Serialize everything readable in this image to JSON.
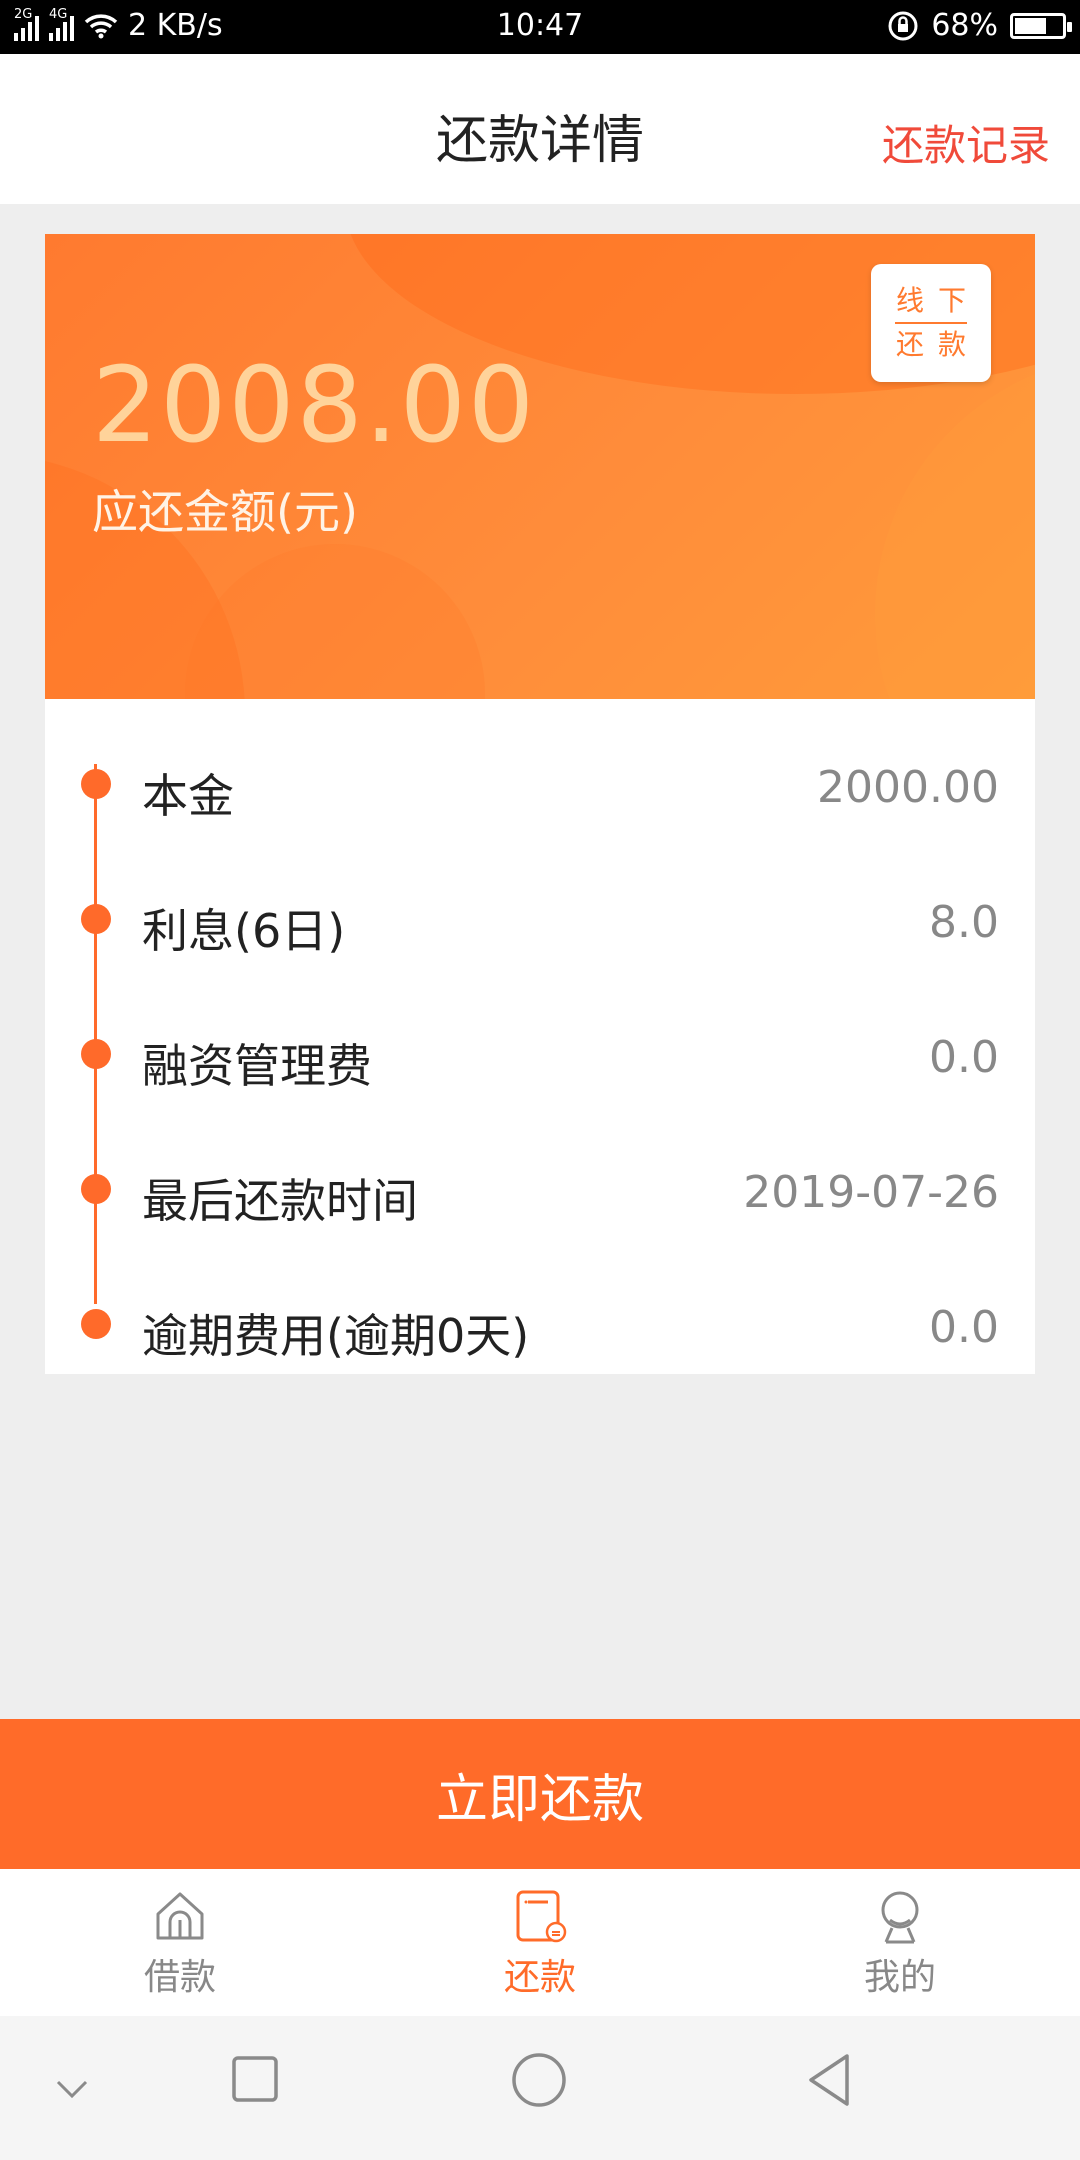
{
  "status_bar": {
    "network_2g": "2G",
    "network_4g": "4G",
    "speed": "2 KB/s",
    "time": "10:47",
    "battery": "68%",
    "battery_level": 0.68
  },
  "header": {
    "title": "还款详情",
    "action": "还款记录"
  },
  "card": {
    "amount": "2008.00",
    "amount_label": "应还金额(元)",
    "offline_top": "线下",
    "offline_bottom": "还款"
  },
  "details": [
    {
      "label": "本金",
      "value": "2000.00"
    },
    {
      "label": "利息(6日)",
      "value": "8.0"
    },
    {
      "label": "融资管理费",
      "value": "0.0"
    },
    {
      "label": "最后还款时间",
      "value": "2019-07-26"
    },
    {
      "label": "逾期费用(逾期0天)",
      "value": "0.0"
    }
  ],
  "repay_button": "立即还款",
  "bottom_nav": {
    "items": [
      {
        "label": "借款",
        "icon": "home-icon",
        "active": false
      },
      {
        "label": "还款",
        "icon": "bill-icon",
        "active": true
      },
      {
        "label": "我的",
        "icon": "user-icon",
        "active": false
      }
    ]
  },
  "colors": {
    "accent": "#ff6b29",
    "header_action": "#f04a3a",
    "amount": "#ffd39a",
    "value_text": "#888888"
  }
}
